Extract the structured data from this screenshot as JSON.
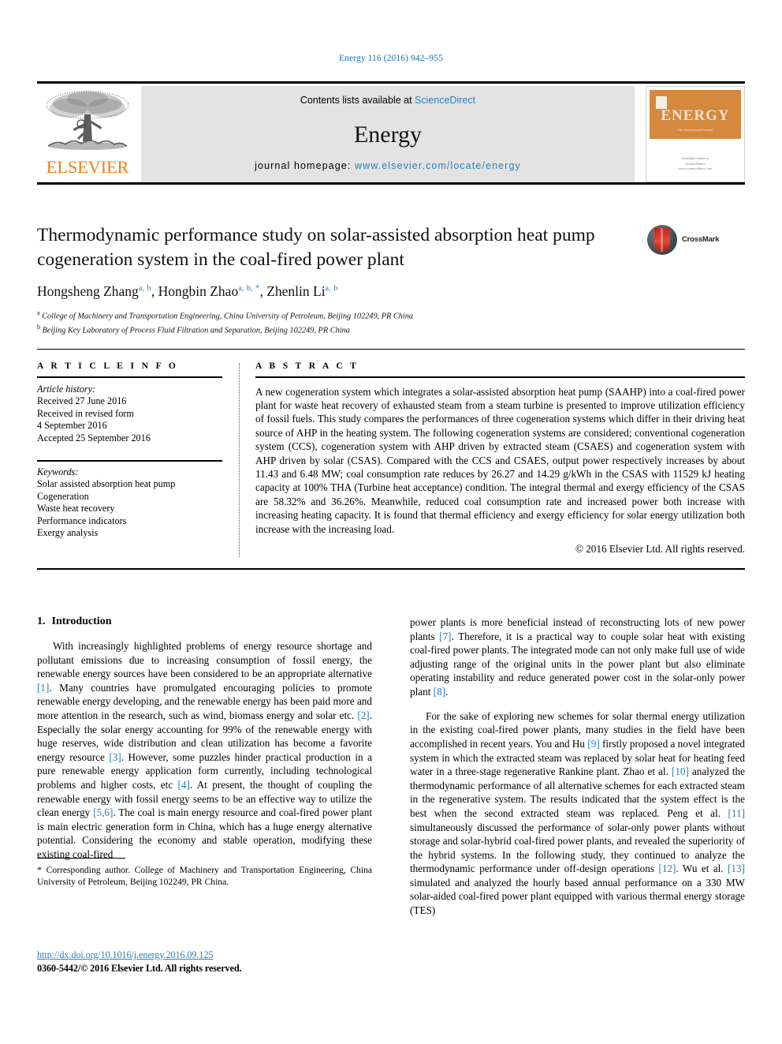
{
  "running_head": "Energy 116 (2016) 942–955",
  "banner": {
    "publisher_logo_text": "ELSEVIER",
    "contents_prefix": "Contents lists available at ",
    "contents_link": "ScienceDirect",
    "journal_name": "Energy",
    "homepage_prefix": "journal homepage: ",
    "homepage_url": "www.elsevier.com/locate/energy",
    "cover": {
      "title": "ENERGY",
      "subtitle": "The International Journal",
      "footer_line1": "Available online at",
      "footer_line2": "ScienceDirect",
      "footer_line3": "www.sciencedirect.com"
    }
  },
  "article": {
    "title": "Thermodynamic performance study on solar-assisted absorption heat pump cogeneration system in the coal-fired power plant",
    "crossmark_label": "CrossMark",
    "authors": [
      {
        "name": "Hongsheng Zhang",
        "marks": "a, b",
        "sep": ", "
      },
      {
        "name": "Hongbin Zhao",
        "marks": "a, b, *",
        "sep": ", "
      },
      {
        "name": "Zhenlin Li",
        "marks": "a, b",
        "sep": ""
      }
    ],
    "affiliations": [
      {
        "mark": "a",
        "text": "College of Machinery and Transportation Engineering, China University of Petroleum, Beijing 102249, PR China"
      },
      {
        "mark": "b",
        "text": "Beijing Key Laboratory of Process Fluid Filtration and Separation, Beijing 102249, PR China"
      }
    ]
  },
  "article_info": {
    "heading": "A R T I C L E  I N F O",
    "history_label": "Article history:",
    "history": [
      "Received 27 June 2016",
      "Received in revised form",
      "4 September 2016",
      "Accepted 25 September 2016"
    ],
    "keywords_label": "Keywords:",
    "keywords": [
      "Solar assisted absorption heat pump",
      "Cogeneration",
      "Waste heat recovery",
      "Performance indicators",
      "Exergy analysis"
    ]
  },
  "abstract": {
    "heading": "A B S T R A C T",
    "text": "A new cogeneration system which integrates a solar-assisted absorption heat pump (SAAHP) into a coal-fired power plant for waste heat recovery of exhausted steam from a steam turbine is presented to improve utilization efficiency of fossil fuels. This study compares the performances of three cogeneration systems which differ in their driving heat source of AHP in the heating system. The following cogeneration systems are considered; conventional cogeneration system (CCS), cogeneration system with AHP driven by extracted steam (CSAES) and cogeneration system with AHP driven by solar (CSAS). Compared with the CCS and CSAES, output power respectively increases by about 11.43 and 6.48 MW; coal consumption rate reduces by 26.27 and 14.29 g/kWh in the CSAS with 11529 kJ heating capacity at 100% THA (Turbine heat acceptance) condition. The integral thermal and exergy efficiency of the CSAS are 58.32% and 36.26%. Meanwhile, reduced coal consumption rate and increased power both increase with increasing heating capacity. It is found that thermal efficiency and exergy efficiency for solar energy utilization both increase with the increasing load.",
    "copyright": "© 2016 Elsevier Ltd. All rights reserved."
  },
  "body": {
    "section_number": "1.",
    "section_title": "Introduction",
    "left_paragraph_1_a": "With increasingly highlighted problems of energy resource shortage and pollutant emissions due to increasing consumption of fossil energy, the renewable energy sources have been considered to be an appropriate alternative ",
    "ref1": "[1]",
    "left_paragraph_1_b": ". Many countries have promulgated encouraging policies to promote renewable energy developing, and the renewable energy has been paid more and more attention in the research, such as wind, biomass energy and solar etc. ",
    "ref2": "[2]",
    "left_paragraph_1_c": ". Especially the solar energy accounting for 99% of the renewable energy with huge reserves, wide distribution and clean utilization has become a favorite energy resource ",
    "ref3": "[3]",
    "left_paragraph_1_d": ". However, some puzzles hinder practical production in a pure renewable energy application form currently, including technological problems and higher costs, etc ",
    "ref4": "[4]",
    "left_paragraph_1_e": ". At present, the thought of coupling the renewable energy with fossil energy seems to be an effective way to utilize the clean energy ",
    "ref56": "[5,6]",
    "left_paragraph_1_f": ". The coal is main energy resource and coal-fired power plant is main electric generation form in China, which has a huge energy alternative potential. Considering the economy and stable operation, modifying these existing coal-fired",
    "right_paragraph_1_a": "power plants is more beneficial instead of reconstructing lots of new power plants ",
    "ref7": "[7]",
    "right_paragraph_1_b": ". Therefore, it is a practical way to couple solar heat with existing coal-fired power plants. The integrated mode can not only make full use of wide adjusting range of the original units in the power plant but also eliminate operating instability and reduce generated power cost in the solar-only power plant ",
    "ref8": "[8]",
    "right_paragraph_1_c": ".",
    "right_paragraph_2_a": "For the sake of exploring new schemes for solar thermal energy utilization in the existing coal-fired power plants, many studies in the field have been accomplished in recent years. You and Hu ",
    "ref9": "[9]",
    "right_paragraph_2_b": " firstly proposed a novel integrated system in which the extracted steam was replaced by solar heat for heating feed water in a three-stage regenerative Rankine plant. Zhao et al. ",
    "ref10": "[10]",
    "right_paragraph_2_c": " analyzed the thermodynamic performance of all alternative schemes for each extracted steam in the regenerative system. The results indicated that the system effect is the best when the second extracted steam was replaced. Peng et al. ",
    "ref11": "[11]",
    "right_paragraph_2_d": " simultaneously discussed the performance of solar-only power plants without storage and solar-hybrid coal-fired power plants, and revealed the superiority of the hybrid systems. In the following study, they continued to analyze the thermodynamic performance under off-design operations ",
    "ref12": "[12]",
    "right_paragraph_2_e": ". Wu et al. ",
    "ref13": "[13]",
    "right_paragraph_2_f": " simulated and analyzed the hourly based annual performance on a 330 MW solar-aided coal-fired power plant equipped with various thermal energy storage (TES)"
  },
  "footnote": {
    "marker": "*",
    "text": " Corresponding author. College of Machinery and Transportation Engineering, China University of Petroleum, Beijing 102249, PR China."
  },
  "footer": {
    "doi": "http://dx.doi.org/10.1016/j.energy.2016.09.125",
    "issn_line": "0360-5442/© 2016 Elsevier Ltd. All rights reserved."
  },
  "colors": {
    "link": "#2a7fb8",
    "running_head": "#1a6ea8",
    "elsevier_orange": "#ee8013",
    "banner_gray": "#e3e3e3",
    "cover_orange": "#d4893f"
  }
}
